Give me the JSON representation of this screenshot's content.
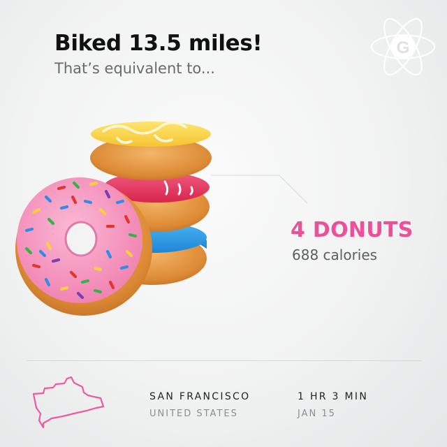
{
  "header": {
    "title": "Biked 13.5 miles!",
    "subtitle": "That’s equivalent to..."
  },
  "logo": {
    "letter": "G",
    "icon": "atom-logo-icon"
  },
  "result": {
    "amount": "4 DONUTS",
    "calories": "688 calories"
  },
  "footer": {
    "city": "SAN FRANCISCO",
    "country": "UNITED STATES",
    "duration": "1 HR 3 MIN",
    "date": "JAN 15"
  },
  "colors": {
    "accent_pink": "#ee4f99",
    "donut_yellow_glaze": "#f9d44a",
    "donut_red_glaze": "#e93762",
    "donut_blue_glaze": "#2e9bea",
    "donut_pink_glaze": "#f59ac2",
    "dough": "#dc8a36"
  }
}
